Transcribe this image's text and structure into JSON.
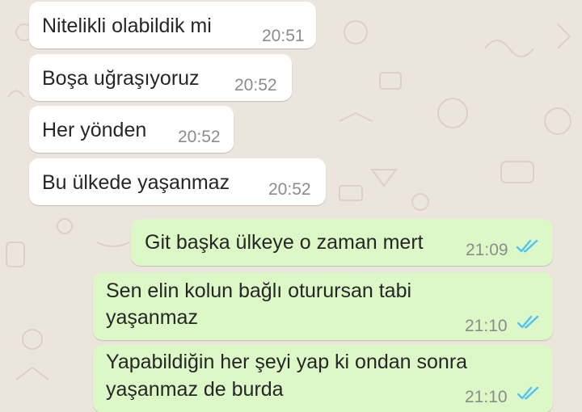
{
  "chat": {
    "incoming": [
      {
        "text": "Nitelikli olabildik mi",
        "time": "20:51"
      },
      {
        "text": "Boşa uğraşıyoruz",
        "time": "20:52"
      },
      {
        "text": "Her yönden",
        "time": "20:52"
      },
      {
        "text": "Bu ülkede yaşanmaz",
        "time": "20:52"
      }
    ],
    "outgoing": [
      {
        "line1": "Git başka ülkeye o zaman mert",
        "time": "21:09",
        "status_icon": "double-check-read-icon"
      },
      {
        "line1": "Sen elin kolun bağlı oturursan tabi",
        "line2": "yaşanmaz",
        "time": "21:10",
        "status_icon": "double-check-read-icon"
      },
      {
        "line1": "Yapabildiğin her şeyi yap ki ondan sonra",
        "line2": "yaşanmaz de burda",
        "time": "21:10",
        "status_icon": "double-check-read-icon"
      }
    ]
  },
  "colors": {
    "background": "#ece5dd",
    "incoming_bubble": "#ffffff",
    "outgoing_bubble": "#dcf8c6",
    "read_ticks": "#4fc3f7",
    "time_text": "#8c8c8c"
  }
}
